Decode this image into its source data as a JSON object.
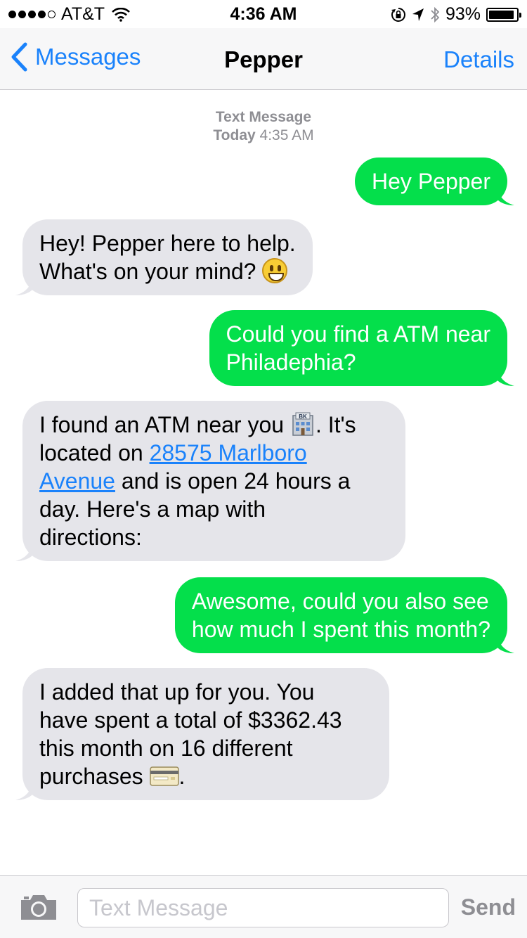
{
  "status_bar": {
    "carrier": "AT&T",
    "time": "4:36 AM",
    "battery_percent": "93%",
    "battery_level": 0.93,
    "signal_bars": 4,
    "signal_total": 5
  },
  "nav": {
    "back_label": "Messages",
    "title": "Pepper",
    "details_label": "Details"
  },
  "thread": {
    "service": "Text Message",
    "day": "Today",
    "time": "4:35 AM"
  },
  "messages": [
    {
      "direction": "outgoing",
      "text": "Hey Pepper"
    },
    {
      "direction": "incoming",
      "line1": "Hey! Pepper here to help.",
      "line2": "What's on your mind?",
      "emoji": "smiley-face-icon"
    },
    {
      "direction": "outgoing",
      "line1": "Could you find a ATM near",
      "line2": "Philadephia?"
    },
    {
      "direction": "incoming",
      "part1": "I found an ATM near you",
      "emoji": "bank-icon",
      "emoji_label": "BK",
      "part2": ". It's",
      "part3": "located on",
      "link": "28575 Marlboro Avenue",
      "link_line1": "28575 Marlboro",
      "link_line2": "Avenue",
      "part4": "and is open 24 hours a",
      "part5": "day. Here's a map with",
      "part6": "directions:"
    },
    {
      "direction": "outgoing",
      "line1": "Awesome, could you also see",
      "line2": "how much I spent this month?"
    },
    {
      "direction": "incoming",
      "line1": "I added that up for you. You",
      "line2": "have spent a total of $3362.43",
      "line3": "this month on 16 different",
      "line4": "purchases",
      "emoji": "credit-card-icon",
      "suffix": "."
    }
  ],
  "input": {
    "placeholder": "Text Message",
    "value": "",
    "send_label": "Send"
  },
  "colors": {
    "accent": "#1a82fb",
    "outgoing_bubble": "#04df4b",
    "incoming_bubble": "#e5e5ea"
  }
}
